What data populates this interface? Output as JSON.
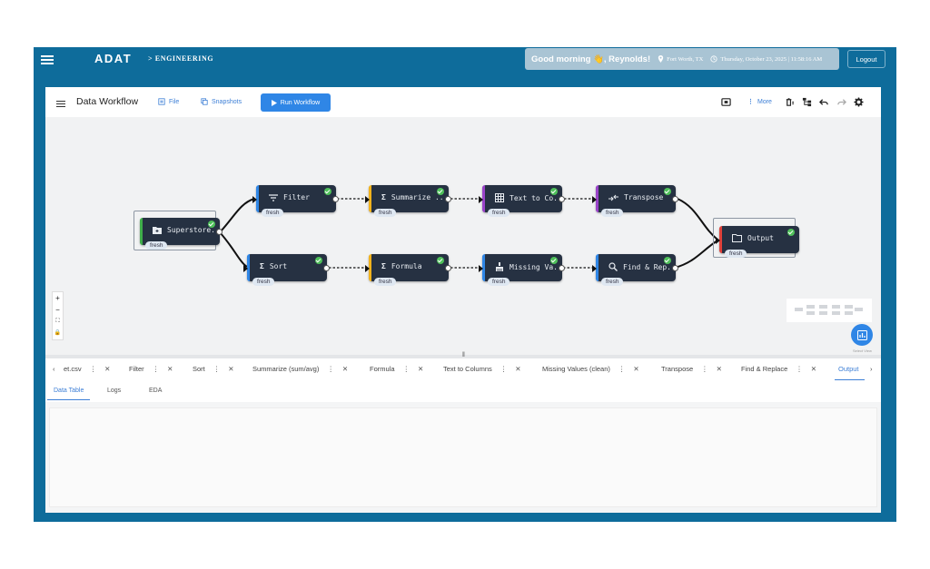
{
  "header": {
    "brand": "ADAT",
    "breadcrumb": "> ENGINEERING",
    "greeting": "Good morning 👋, Reynolds!",
    "location": "Fort Worth, TX",
    "datetime": "Thursday, October 23, 2025 | 11:58:16 AM",
    "logout_label": "Logout"
  },
  "toolbar": {
    "title": "Data Workflow",
    "file_label": "File",
    "snapshots_label": "Snapshots",
    "run_label": "Run Workflow",
    "more_label": "More"
  },
  "nodes": {
    "source": {
      "label": "Superstore...",
      "status": "fresh"
    },
    "filter": {
      "label": "Filter",
      "status": "fresh"
    },
    "summarize": {
      "label": "Summarize ...",
      "status": "fresh"
    },
    "text_to_columns": {
      "label": "Text to Co...",
      "status": "fresh"
    },
    "transpose": {
      "label": "Transpose",
      "status": "fresh"
    },
    "sort": {
      "label": "Sort",
      "status": "fresh"
    },
    "formula": {
      "label": "Formula",
      "status": "fresh"
    },
    "missing_values": {
      "label": "Missing Va...",
      "status": "fresh"
    },
    "find_replace": {
      "label": "Find & Rep...",
      "status": "fresh"
    },
    "output": {
      "label": "Output",
      "status": "fresh"
    }
  },
  "canvas_controls": {
    "zoom_in": "+",
    "zoom_out": "−",
    "fit": "⛶",
    "lock": "🔒"
  },
  "fab_caption": "Select View",
  "tabs": [
    {
      "label": "et.csv"
    },
    {
      "label": "Filter"
    },
    {
      "label": "Sort"
    },
    {
      "label": "Summarize (sum/avg)"
    },
    {
      "label": "Formula"
    },
    {
      "label": "Text to Columns"
    },
    {
      "label": "Missing Values (clean)"
    },
    {
      "label": "Transpose"
    },
    {
      "label": "Find & Replace"
    },
    {
      "label": "Output"
    }
  ],
  "subtabs": [
    "Data Table",
    "Logs",
    "EDA"
  ],
  "colors": {
    "app_bg": "#0e6c9b",
    "accent": "#2f86e6",
    "node_bg": "#263142",
    "success": "#4fc05a"
  }
}
